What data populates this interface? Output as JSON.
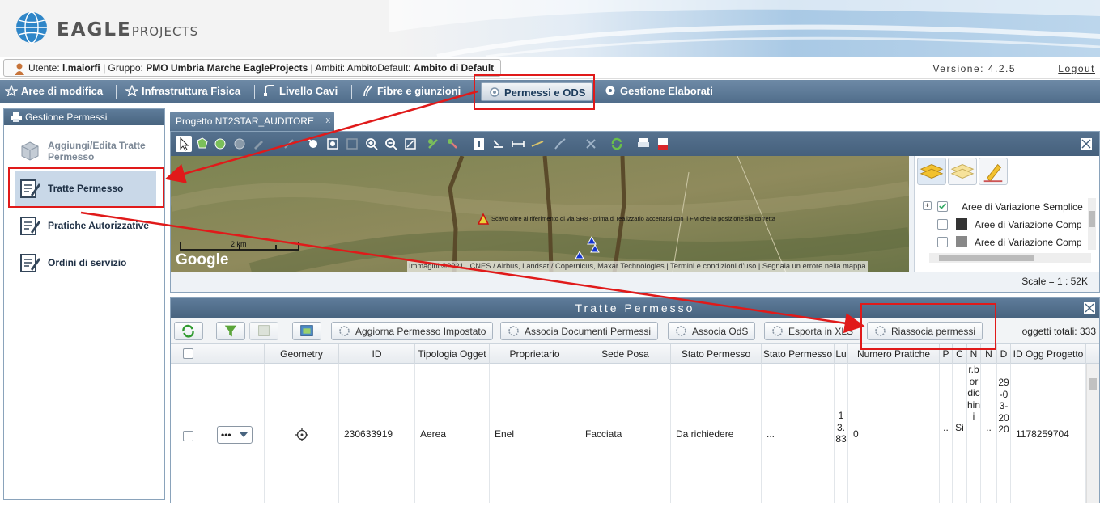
{
  "header": {
    "logo_main": "EAGLE",
    "logo_sub": "PROJECTS"
  },
  "userbar": {
    "user_label": "Utente:",
    "user": "l.maiorfi",
    "group_label": " | Gruppo:",
    "group": "PMO Umbria Marche EagleProjects",
    "ambiti_label": " | Ambiti: AmbitoDefault:",
    "ambito": "Ambito di Default",
    "version": "Versione: 4.2.5",
    "logout": "Logout"
  },
  "topmenu": [
    {
      "label": "Aree di modifica"
    },
    {
      "label": "Infrastruttura Fisica"
    },
    {
      "label": "Livello Cavi"
    },
    {
      "label": "Fibre e giunzioni"
    },
    {
      "label": "Permessi e ODS"
    },
    {
      "label": "Gestione Elaborati"
    }
  ],
  "sidebar": {
    "title": "Gestione Permessi",
    "items": [
      {
        "label": "Aggiungi/Edita Tratte Permesso",
        "enabled": false
      },
      {
        "label": "Tratte Permesso",
        "selected": true
      },
      {
        "label": "Pratiche Autorizzative"
      },
      {
        "label": "Ordini di servizio"
      }
    ]
  },
  "project_tab": {
    "label": "Progetto NT2STAR_AUDITORE",
    "close": "x"
  },
  "map": {
    "annotation": "Scavo oltre al riferimento di via SR8 - prima di realizzarlo accertarsi con il FM che la posizione sia corretta",
    "scale_bar": "2 km",
    "google": "Google",
    "attribution": "Immagini ©2021 , CNES / Airbus, Landsat / Copernicus, Maxar Technologies",
    "terms": "Termini e condizioni d'uso",
    "report": "Segnala un errore nella mappa",
    "scale": "Scale = 1 : 52K"
  },
  "layers": [
    {
      "label": "Aree di Variazione Semplice",
      "checked": true
    },
    {
      "label": "Aree di Variazione Comp",
      "checked": false
    },
    {
      "label": "Aree di Variazione Comp",
      "checked": false
    }
  ],
  "grid": {
    "title": "Tratte Permesso",
    "buttons": {
      "aggiorna": "Aggiorna Permesso Impostato",
      "associa_doc": "Associa Documenti Permessi",
      "associa_ods": "Associa OdS",
      "esporta": "Esporta in XLS",
      "riassocia": "Riassocia permessi"
    },
    "total": "oggetti totali: 333",
    "columns": [
      "Geometry",
      "ID",
      "Tipologia Ogget",
      "Proprietario",
      "Sede Posa",
      "Stato Permesso",
      "Stato Permesso",
      "Lu",
      "Numero Pratiche",
      "P",
      "C",
      "N",
      "N",
      "D",
      "ID Ogg Progetto"
    ],
    "row": {
      "menu": "•••",
      "id": "230633919",
      "tipologia": "Aerea",
      "proprietario": "Enel",
      "sede": "Facciata",
      "stato": "Da richiedere",
      "stato2": "...",
      "lu": "13.83",
      "pratiche": "0",
      "p": "..",
      "c": "Si",
      "n1": "r.bordichini",
      "n2": "..",
      "d": "29-03-2020",
      "id_ogg": "1178259704"
    }
  },
  "colors": {
    "accent_nav": "#56728f",
    "annotation_red": "#e01a1a",
    "selected_item": "#c9d8e8"
  }
}
